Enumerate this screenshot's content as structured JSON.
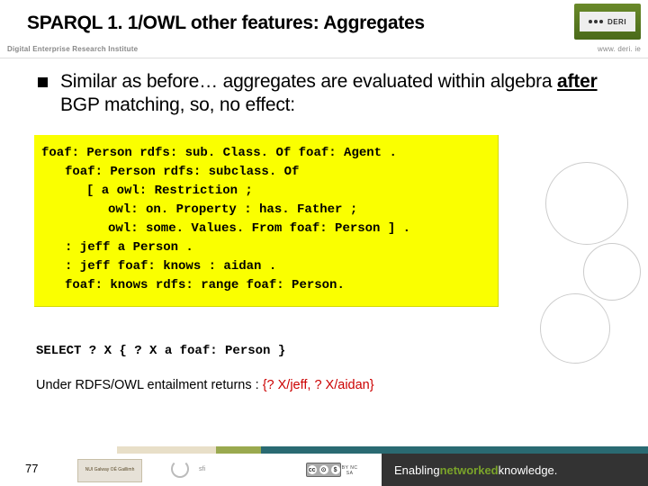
{
  "header": {
    "title": "SPARQL 1. 1/OWL other features: Aggregates",
    "institute": "Digital Enterprise Research Institute",
    "url": "www. deri. ie",
    "logo_text": "DERI"
  },
  "body": {
    "bullet_pre": "Similar as before… aggregates are evaluated within algebra ",
    "bullet_after": "after",
    "bullet_post": " BGP matching, so, no effect:",
    "code": {
      "l1": "foaf: Person rdfs: sub. Class. Of foaf: Agent .",
      "l2": "foaf: Person rdfs: subclass. Of",
      "l3": "[ a owl: Restriction ;",
      "l4": "owl: on. Property : has. Father ;",
      "l5": "owl: some. Values. From foaf: Person ] .",
      "l6": ": jeff a Person .",
      "l7": ": jeff foaf: knows : aidan .",
      "l8": "foaf: knows rdfs: range foaf: Person."
    },
    "query": "SELECT ? X { ? X a foaf: Person }",
    "result_pre": "Under RDFS/OWL entailment returns : ",
    "result_bindings": "{? X/jeff,  ? X/aidan}"
  },
  "footer": {
    "page": "77",
    "nui_label": "NUI Galway\nOÉ Gaillimh",
    "sfi_label": "sfi",
    "cc_label": "BY NC SA",
    "enabling": "Enabling ",
    "networked": "networked",
    "knowledge": " knowledge."
  }
}
